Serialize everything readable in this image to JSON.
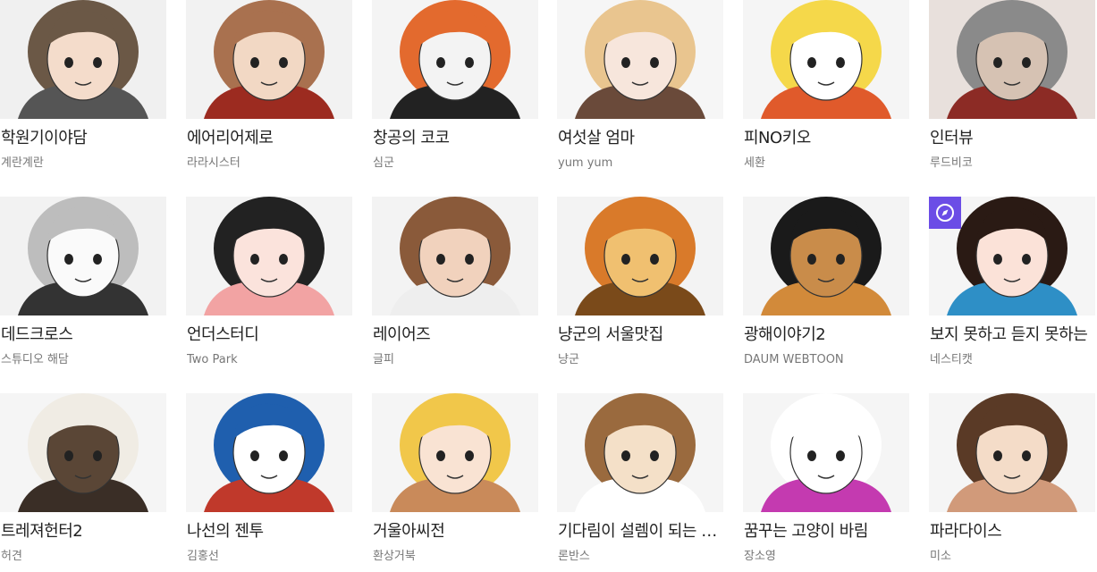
{
  "colors": {
    "title": "#222222",
    "author": "#777777",
    "thumb_bg": "#eeeeee",
    "badge": "#6b4de6"
  },
  "items": [
    {
      "title": "학원기이야담",
      "author": "계란계란",
      "thumb": "brown-hair-glasses-character",
      "bg": "#f0f0f0",
      "skin": "#f4dccb",
      "hair": "#6b5846",
      "accent": "#555555"
    },
    {
      "title": "에어리어제로",
      "author": "라라시스터",
      "thumb": "brown-hair-red-coat-character",
      "bg": "#f2f2f2",
      "skin": "#f2d8c4",
      "hair": "#a9714f",
      "accent": "#9c2b20"
    },
    {
      "title": "창공의 코코",
      "author": "심군",
      "thumb": "orange-cat-character",
      "bg": "#f4f4f4",
      "skin": "#f3f3f3",
      "hair": "#e36a2e",
      "accent": "#222222"
    },
    {
      "title": "여섯살 엄마",
      "author": "yum yum",
      "thumb": "blonde-curly-child-character",
      "bg": "#f6f6f6",
      "skin": "#f7e6dc",
      "hair": "#e9c58f",
      "accent": "#6a4a3a"
    },
    {
      "title": "피NO키오",
      "author": "세환",
      "thumb": "pinocchio-yellow-hat-character",
      "bg": "#f5f5f5",
      "skin": "#ffffff",
      "hair": "#f5d84a",
      "accent": "#e05a2b"
    },
    {
      "title": "인터뷰",
      "author": "루드비코",
      "thumb": "old-man-portrait",
      "bg": "#e8e0dc",
      "skin": "#d6c2b3",
      "hair": "#8a8a8a",
      "accent": "#8c2b25"
    },
    {
      "title": "데드크로스",
      "author": "스튜디오 해담",
      "thumb": "sketch-girl-character",
      "bg": "#f2f2f2",
      "skin": "#fafafa",
      "hair": "#bdbdbd",
      "accent": "#333333"
    },
    {
      "title": "언더스터디",
      "author": "Two Park",
      "thumb": "black-hair-smiling-boy-character",
      "bg": "#f3f3f3",
      "skin": "#fbe3dc",
      "hair": "#222222",
      "accent": "#f2a3a3"
    },
    {
      "title": "레이어즈",
      "author": "글피",
      "thumb": "brown-hair-boy-character",
      "bg": "#f3f3f3",
      "skin": "#f1d2bd",
      "hair": "#8a5a3a",
      "accent": "#eeeeee"
    },
    {
      "title": "냥군의 서울맛집",
      "author": "냥군",
      "thumb": "toasted-food-on-chopsticks",
      "bg": "#f3f3f3",
      "skin": "#f0c070",
      "hair": "#d97a2a",
      "accent": "#7a4a1a"
    },
    {
      "title": "광해이야기2",
      "author": "DAUM WEBTOON",
      "thumb": "dark-skin-boy-character",
      "bg": "#f4f4f4",
      "skin": "#c98c4a",
      "hair": "#1a1a1a",
      "accent": "#d28a3a"
    },
    {
      "title": "보지 못하고 듣지 못하는",
      "author": "네스티캣",
      "thumb": "smiling-long-hair-girl-character",
      "bg": "#f5f5f5",
      "skin": "#fbe2d8",
      "hair": "#2a1a14",
      "accent": "#2e8fc6",
      "badge": "compass-icon"
    },
    {
      "title": "트레져헌터2",
      "author": "허견",
      "thumb": "white-hair-dark-skin-character",
      "bg": "#f5f5f5",
      "skin": "#5a4636",
      "hair": "#f0ece4",
      "accent": "#3a2e26"
    },
    {
      "title": "나선의 젠투",
      "author": "김홍선",
      "thumb": "penguin-character",
      "bg": "#f5f5f5",
      "skin": "#ffffff",
      "hair": "#1f5fae",
      "accent": "#c0392b"
    },
    {
      "title": "거울아씨전",
      "author": "환상거북",
      "thumb": "blonde-girl-character",
      "bg": "#f5f5f5",
      "skin": "#f9e3d3",
      "hair": "#f1c74a",
      "accent": "#c98a5a"
    },
    {
      "title": "기다림이 설렘이 되는 시간",
      "author": "론반스",
      "thumb": "brown-hair-student-character",
      "bg": "#f5f5f5",
      "skin": "#f4e0c8",
      "hair": "#9a6a3e",
      "accent": "#ffffff"
    },
    {
      "title": "꿈꾸는 고양이 바림",
      "author": "장소영",
      "thumb": "white-cat-character",
      "bg": "#f5f5f5",
      "skin": "#ffffff",
      "hair": "#ffffff",
      "accent": "#c43ab0"
    },
    {
      "title": "파라다이스",
      "author": "미소",
      "thumb": "brown-hair-woman-character",
      "bg": "#f5f5f5",
      "skin": "#f4dcc8",
      "hair": "#5a3a26",
      "accent": "#d19a7a"
    }
  ]
}
